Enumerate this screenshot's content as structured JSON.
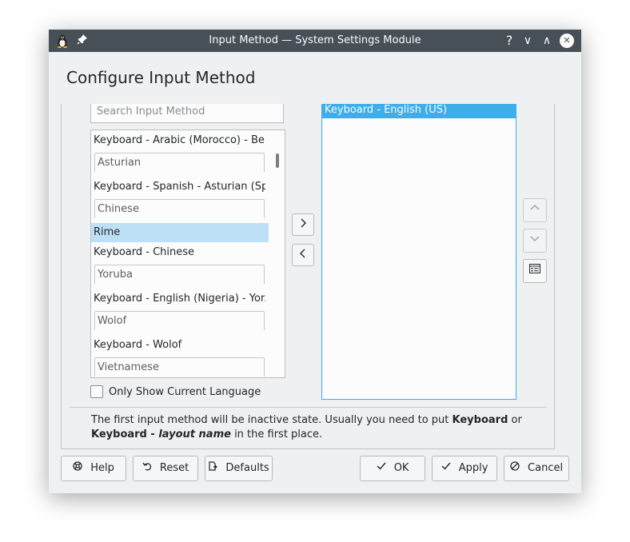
{
  "window": {
    "title": "Input Method — System Settings Module"
  },
  "titlebar_icons": {
    "app": "linux-penguin-icon",
    "pin": "pin-icon",
    "help": "?",
    "minimize": "∨",
    "maximize": "∧",
    "close": "✕"
  },
  "page": {
    "heading": "Configure Input Method"
  },
  "search": {
    "placeholder": "Search Input Method"
  },
  "available": {
    "items": [
      {
        "kind": "text",
        "label": "Keyboard - Arabic (Morocco) - Ber..."
      },
      {
        "kind": "lang",
        "label": "Asturian"
      },
      {
        "kind": "text",
        "label": "Keyboard - Spanish - Asturian (Sp..."
      },
      {
        "kind": "lang",
        "label": "Chinese"
      },
      {
        "kind": "selected",
        "label": "Rime"
      },
      {
        "kind": "text",
        "label": "Keyboard - Chinese"
      },
      {
        "kind": "lang",
        "label": "Yoruba"
      },
      {
        "kind": "text",
        "label": "Keyboard - English (Nigeria) - Yor..."
      },
      {
        "kind": "lang",
        "label": "Wolof"
      },
      {
        "kind": "text",
        "label": "Keyboard - Wolof"
      },
      {
        "kind": "lang",
        "label": "Vietnamese"
      }
    ]
  },
  "move": {
    "add": "›",
    "remove": "‹"
  },
  "current": {
    "selected": "Keyboard - English (US)"
  },
  "side": {
    "up": "∧",
    "down": "∨"
  },
  "options": {
    "only_current_language": "Only Show Current Language"
  },
  "note": {
    "part1": "The first input method will be inactive state. Usually you need to put ",
    "kb": "Keyboard",
    "or": " or ",
    "kbl": "Keyboard - ",
    "layout": "layout name",
    "part2": " in the first place."
  },
  "buttons": {
    "help": "Help",
    "reset": "Reset",
    "defaults": "Defaults",
    "ok": "OK",
    "apply": "Apply",
    "cancel": "Cancel"
  },
  "colors": {
    "accent": "#3daee9",
    "selection_light": "#bee0f7",
    "titlebar": "#475057"
  }
}
